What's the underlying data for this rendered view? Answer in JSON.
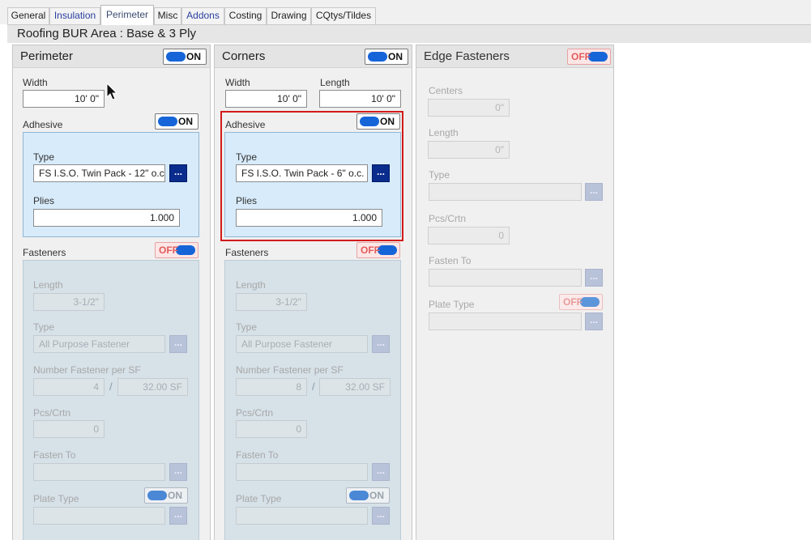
{
  "tabs": [
    {
      "label": "General"
    },
    {
      "label": "Insulation"
    },
    {
      "label": "Perimeter"
    },
    {
      "label": "Misc"
    },
    {
      "label": "Addons"
    },
    {
      "label": "Costing"
    },
    {
      "label": "Drawing"
    },
    {
      "label": "CQtys/Tildes"
    }
  ],
  "header": {
    "title": "Roofing BUR Area : Base & 3 Ply"
  },
  "perimeter": {
    "title": "Perimeter",
    "toggle": "ON",
    "width_label": "Width",
    "width_value": "10' 0\"",
    "adhesive_label": "Adhesive",
    "adhesive_toggle": "ON",
    "type_label": "Type",
    "type_value": "FS I.S.O. Twin Pack - 12\" o.c.",
    "browse": "...",
    "plies_label": "Plies",
    "plies_value": "1.000",
    "fasteners_label": "Fasteners",
    "fasteners_toggle": "OFF",
    "length_label": "Length",
    "length_value": "3-1/2\"",
    "ftype_label": "Type",
    "ftype_value": "All Purpose Fastener",
    "num_label": "Number Fastener per SF",
    "num_value": "4",
    "slash": "/",
    "sf_value": "32.00 SF",
    "pcs_label": "Pcs/Crtn",
    "pcs_value": "0",
    "fasten_label": "Fasten To",
    "plate_label": "Plate Type",
    "plate_toggle": "ON"
  },
  "corners": {
    "title": "Corners",
    "toggle": "ON",
    "width_label": "Width",
    "width_value": "10' 0\"",
    "length_label": "Length",
    "length_value": "10' 0\"",
    "adhesive_label": "Adhesive",
    "adhesive_toggle": "ON",
    "type_label": "Type",
    "type_value": "FS I.S.O. Twin Pack - 6\" o.c.",
    "browse": "...",
    "plies_label": "Plies",
    "plies_value": "1.000",
    "fasteners_label": "Fasteners",
    "fasteners_toggle": "OFF",
    "length2_label": "Length",
    "length2_value": "3-1/2\"",
    "ftype_label": "Type",
    "ftype_value": "All Purpose Fastener",
    "num_label": "Number Fastener per SF",
    "num_value": "8",
    "slash": "/",
    "sf_value": "32.00 SF",
    "pcs_label": "Pcs/Crtn",
    "pcs_value": "0",
    "fasten_label": "Fasten To",
    "plate_label": "Plate Type",
    "plate_toggle": "ON"
  },
  "edge": {
    "title": "Edge Fasteners",
    "toggle": "OFF",
    "centers_label": "Centers",
    "centers_value": "0\"",
    "length_label": "Length",
    "length_value": "0\"",
    "type_label": "Type",
    "pcs_label": "Pcs/Crtn",
    "pcs_value": "0",
    "fasten_label": "Fasten To",
    "plate_label": "Plate Type",
    "plate_toggle": "OFF"
  },
  "colors": {
    "accent": "#1565d8",
    "highlight": "#d21a1a",
    "browse": "#0a2c8c"
  },
  "icons": {
    "cursor": "mouse-pointer-icon",
    "browse": "ellipsis-icon"
  }
}
